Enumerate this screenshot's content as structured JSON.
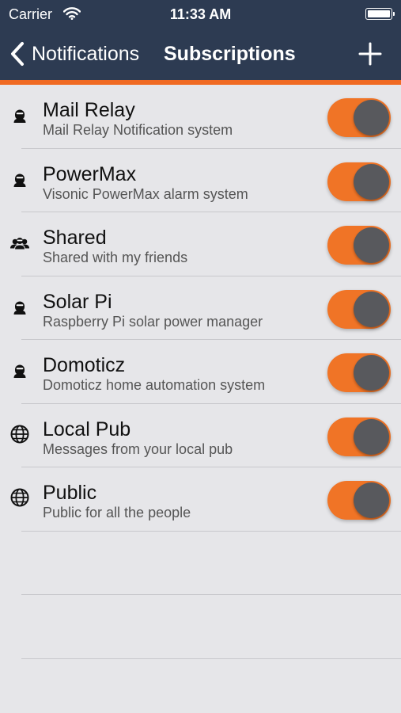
{
  "status_bar": {
    "carrier": "Carrier",
    "time": "11:33 AM"
  },
  "nav": {
    "back_label": "Notifications",
    "title": "Subscriptions"
  },
  "colors": {
    "navbar": "#2d3b52",
    "accent": "#f06a23",
    "toggle_on": "#f07426",
    "knob": "#58595d"
  },
  "subscriptions": [
    {
      "name": "Mail Relay",
      "description": "Mail Relay Notification system",
      "icon": "user-icon",
      "enabled": true
    },
    {
      "name": "PowerMax",
      "description": "Visonic PowerMax alarm system",
      "icon": "user-icon",
      "enabled": true
    },
    {
      "name": "Shared",
      "description": "Shared with my friends",
      "icon": "group-icon",
      "enabled": true
    },
    {
      "name": "Solar Pi",
      "description": "Raspberry Pi solar power manager",
      "icon": "user-icon",
      "enabled": true
    },
    {
      "name": "Domoticz",
      "description": "Domoticz home automation system",
      "icon": "user-icon",
      "enabled": true
    },
    {
      "name": "Local Pub",
      "description": "Messages from your local pub",
      "icon": "globe-icon",
      "enabled": true
    },
    {
      "name": "Public",
      "description": "Public for all the people",
      "icon": "globe-icon",
      "enabled": true
    }
  ]
}
